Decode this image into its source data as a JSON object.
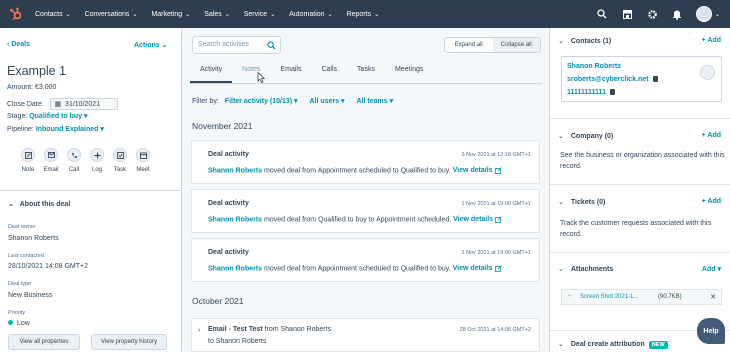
{
  "nav": {
    "items": [
      "Contacts",
      "Conversations",
      "Marketing",
      "Sales",
      "Service",
      "Automation",
      "Reports"
    ],
    "brand_color": "#ff7a59",
    "bg_color": "#2d3e50"
  },
  "left": {
    "back_link": "Deals",
    "actions_label": "Actions",
    "title": "Example 1",
    "amount": "Amount: €3,000",
    "close_date_label": "Close Date:",
    "close_date_value": "31/10/2021",
    "stage_label": "Stage:",
    "stage_value": "Qualified to buy",
    "pipeline_label": "Pipeline:",
    "pipeline_value": "Inbound Explained",
    "quick_actions": [
      "Note",
      "Email",
      "Call",
      "Log",
      "Task",
      "Meet"
    ],
    "about_title": "About this deal",
    "fields": [
      {
        "label": "Deal owner",
        "value": "Shanon Roberts"
      },
      {
        "label": "Last contacted",
        "value": "28/10/2021 14:08 GMT+2"
      },
      {
        "label": "Deal type",
        "value": "New Business"
      },
      {
        "label": "Priority",
        "value": "Low"
      }
    ],
    "buttons": [
      "View all properties",
      "View property history"
    ]
  },
  "middle": {
    "search_placeholder": "Search activities",
    "expand_all": "Expand all",
    "collapse_all": "Collapse all",
    "tabs": [
      "Activity",
      "Notes",
      "Emails",
      "Calls",
      "Tasks",
      "Meetings"
    ],
    "filter_label": "Filter by:",
    "filter_activity": "Filter activity (10/13)",
    "filter_users": "All users",
    "filter_teams": "All teams",
    "month1": "November 2021",
    "month2": "October 2021",
    "cards": [
      {
        "title": "Deal activity",
        "date": "3 Nov 2021 at 12:18 GMT+1",
        "who": "Shanon Roberts",
        "text": " moved deal from Appointment scheduled to Qualified to buy. ",
        "link": "View details"
      },
      {
        "title": "Deal activity",
        "date": "1 Nov 2021 at 19:00 GMT+1",
        "who": "Shanon Roberts",
        "text": " moved deal from Qualified to buy to Appointment scheduled. ",
        "link": "View details"
      },
      {
        "title": "Deal activity",
        "date": "1 Nov 2021 at 19:00 GMT+1",
        "who": "Shanon Roberts",
        "text": " moved deal from Appointment scheduled to Qualified to buy. ",
        "link": "View details"
      }
    ],
    "email": {
      "title_bold": "Email - Test Test",
      "title_rest": " from Shanon Roberts",
      "date": "28 Oct 2021 at 14:08 GMT+2",
      "to": "to Shanon Roberts"
    }
  },
  "right": {
    "contacts_title": "Contacts (1)",
    "add": "+ Add",
    "contact_name": "Shanon Roberts",
    "contact_email": "sroberts@cyberclick.net",
    "contact_phone": "11111111111",
    "company_title": "Company (0)",
    "company_desc": "See the business or organization associated with this record.",
    "tickets_title": "Tickets (0)",
    "tickets_desc": "Track the customer requests associated with this record.",
    "attachments_title": "Attachments",
    "attach_add": "Add",
    "attach_name": "Screen Shot 2021-1...",
    "attach_size": "(90.7KB)",
    "attribution_title": "Deal create attribution",
    "new_badge": "NEW"
  },
  "help_label": "Help"
}
